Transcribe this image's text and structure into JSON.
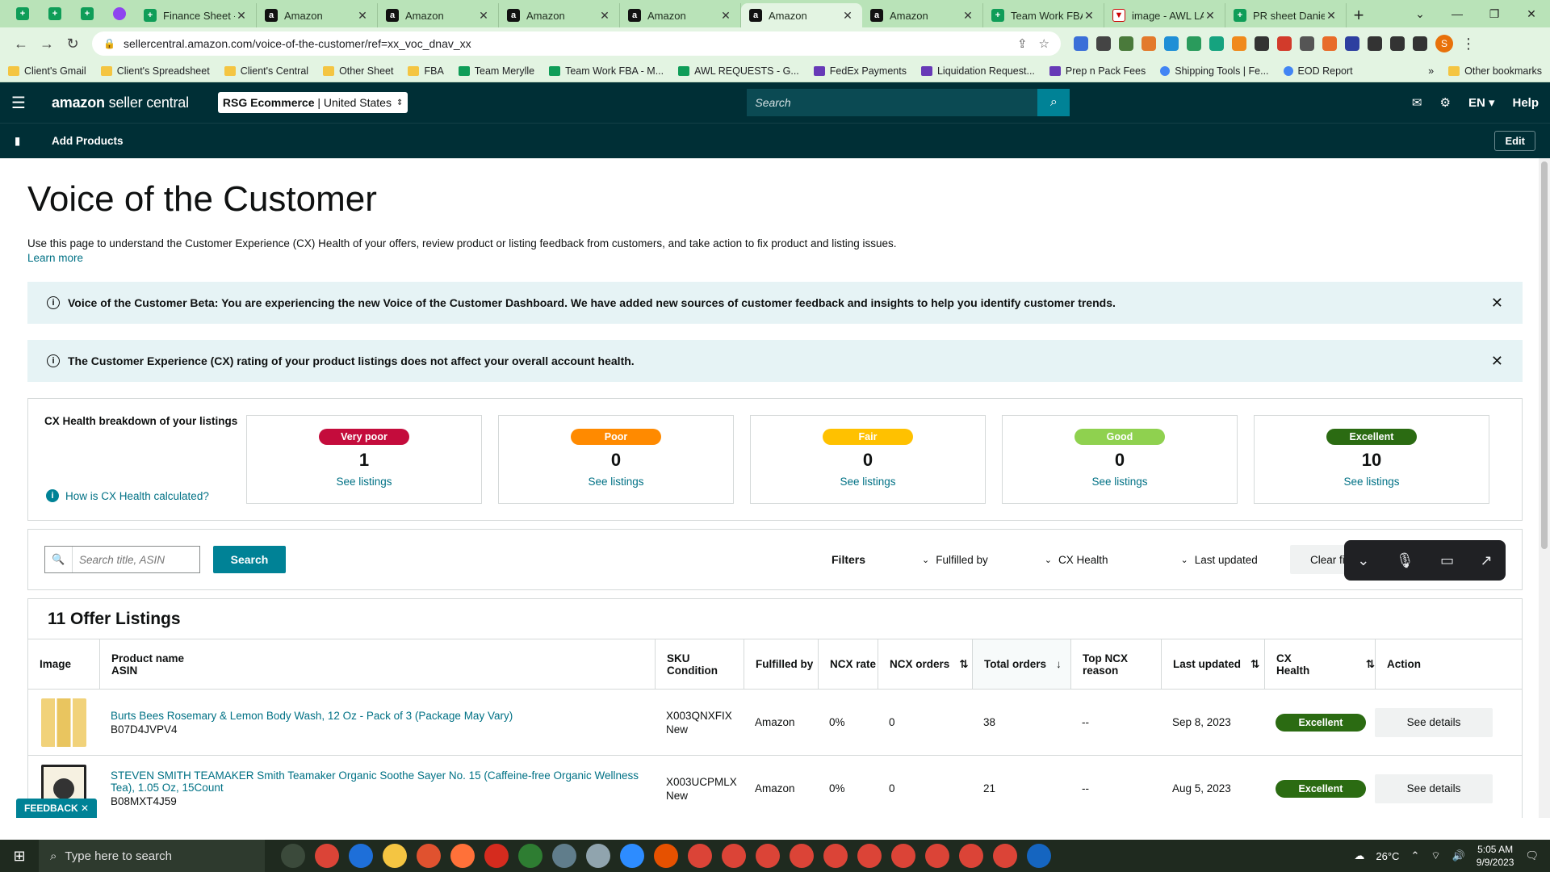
{
  "browser": {
    "tabs": [
      {
        "label": "",
        "type": "sheet",
        "pinned": true
      },
      {
        "label": "",
        "type": "sheet",
        "pinned": true
      },
      {
        "label": "",
        "type": "sheet",
        "pinned": true
      },
      {
        "label": "",
        "type": "messenger",
        "pinned": true
      },
      {
        "label": "Finance Sheet -",
        "type": "sheet"
      },
      {
        "label": "Amazon",
        "type": "amz"
      },
      {
        "label": "Amazon",
        "type": "amz"
      },
      {
        "label": "Amazon",
        "type": "amz"
      },
      {
        "label": "Amazon",
        "type": "amz"
      },
      {
        "label": "Amazon",
        "type": "amz",
        "active": true
      },
      {
        "label": "Amazon",
        "type": "amz"
      },
      {
        "label": "Team Work FBA",
        "type": "sheet"
      },
      {
        "label": "image - AWL LA",
        "type": "awl"
      },
      {
        "label": "PR sheet Danie",
        "type": "sheet"
      }
    ],
    "url": "sellercentral.amazon.com/voice-of-the-customer/ref=xx_voc_dnav_xx",
    "bookmarks": [
      {
        "label": "Client's Gmail",
        "icon": "folder"
      },
      {
        "label": "Client's Spreadsheet",
        "icon": "folder"
      },
      {
        "label": "Client's Central",
        "icon": "folder"
      },
      {
        "label": "Other Sheet",
        "icon": "folder"
      },
      {
        "label": "FBA",
        "icon": "folder"
      },
      {
        "label": "Team Merylle",
        "icon": "sheet"
      },
      {
        "label": "Team Work FBA - M...",
        "icon": "sheet"
      },
      {
        "label": "AWL REQUESTS - G...",
        "icon": "sheet"
      },
      {
        "label": "FedEx Payments",
        "icon": "form"
      },
      {
        "label": "Liquidation Request...",
        "icon": "form"
      },
      {
        "label": "Prep n Pack Fees",
        "icon": "form"
      },
      {
        "label": "Shipping Tools | Fe...",
        "icon": "chrome"
      },
      {
        "label": "EOD Report",
        "icon": "chrome"
      }
    ],
    "other_bookmarks": "Other bookmarks",
    "profile_initial": "S"
  },
  "header": {
    "logo_brand": "amazon",
    "logo_product": "seller central",
    "account_name": "RSG Ecommerce",
    "account_region": "| United States",
    "search_placeholder": "Search",
    "language": "EN",
    "help": "Help",
    "subnav_item": "Add Products",
    "edit": "Edit"
  },
  "page": {
    "title": "Voice of the Customer",
    "description": "Use this page to understand the Customer Experience (CX) Health of your offers, review product or listing feedback from customers, and take action to fix product and listing issues.",
    "learn_more": "Learn more",
    "alerts": [
      "Voice of the Customer Beta: You are experiencing the new Voice of the Customer Dashboard. We have added new sources of customer feedback and insights to help you identify customer trends.",
      "The Customer Experience (CX) rating of your product listings does not affect your overall account health."
    ]
  },
  "cx_health": {
    "title": "CX Health breakdown of your listings",
    "how_link": "How is CX Health calculated?",
    "cards": [
      {
        "label": "Very poor",
        "count": "1",
        "link": "See listings",
        "color": "#c40c3c"
      },
      {
        "label": "Poor",
        "count": "0",
        "link": "See listings",
        "color": "#ff8a00"
      },
      {
        "label": "Fair",
        "count": "0",
        "link": "See listings",
        "color": "#ffc100"
      },
      {
        "label": "Good",
        "count": "0",
        "link": "See listings",
        "color": "#8fd14f"
      },
      {
        "label": "Excellent",
        "count": "10",
        "link": "See listings",
        "color": "#2b6b12"
      }
    ]
  },
  "filters": {
    "search_placeholder": "Search title, ASIN",
    "search_button": "Search",
    "label": "Filters",
    "dropdowns": [
      "Fulfilled by",
      "CX Health",
      "Last updated"
    ],
    "clear": "Clear filt"
  },
  "listings": {
    "title": "11 Offer Listings",
    "columns": {
      "image": "Image",
      "product_name": "Product name",
      "asin": "ASIN",
      "sku": "SKU",
      "condition": "Condition",
      "fulfilled_by": "Fulfilled by",
      "ncx_rate": "NCX rate",
      "ncx_orders": "NCX orders",
      "total_orders": "Total orders",
      "top_ncx_reason": "Top NCX reason",
      "last_updated": "Last updated",
      "cx_health": "CX Health",
      "action": "Action"
    },
    "rows": [
      {
        "name": "Burts Bees Rosemary & Lemon Body Wash, 12 Oz - Pack of 3 (Package May Vary)",
        "asin": "B07D4JVPV4",
        "sku": "X003QNXFIX",
        "condition": "New",
        "fulfilled_by": "Amazon",
        "ncx_rate": "0%",
        "ncx_orders": "0",
        "total_orders": "38",
        "top_ncx_reason": "--",
        "last_updated": "Sep 8, 2023",
        "cx_health": "Excellent",
        "action": "See details",
        "image": "bottles"
      },
      {
        "name": "STEVEN SMITH TEAMAKER Smith Teamaker Organic Soothe Sayer No. 15 (Caffeine-free Organic Wellness Tea), 1.05 Oz, 15Count",
        "asin": "B08MXT4J59",
        "sku": "X003UCPMLX",
        "condition": "New",
        "fulfilled_by": "Amazon",
        "ncx_rate": "0%",
        "ncx_orders": "0",
        "total_orders": "21",
        "top_ncx_reason": "--",
        "last_updated": "Aug 5, 2023",
        "cx_health": "Excellent",
        "action": "See details",
        "image": "tea"
      }
    ]
  },
  "feedback": "FEEDBACK",
  "taskbar": {
    "search_placeholder": "Type here to search",
    "temperature": "26°C",
    "time": "5:05 AM",
    "date": "9/9/2023"
  }
}
